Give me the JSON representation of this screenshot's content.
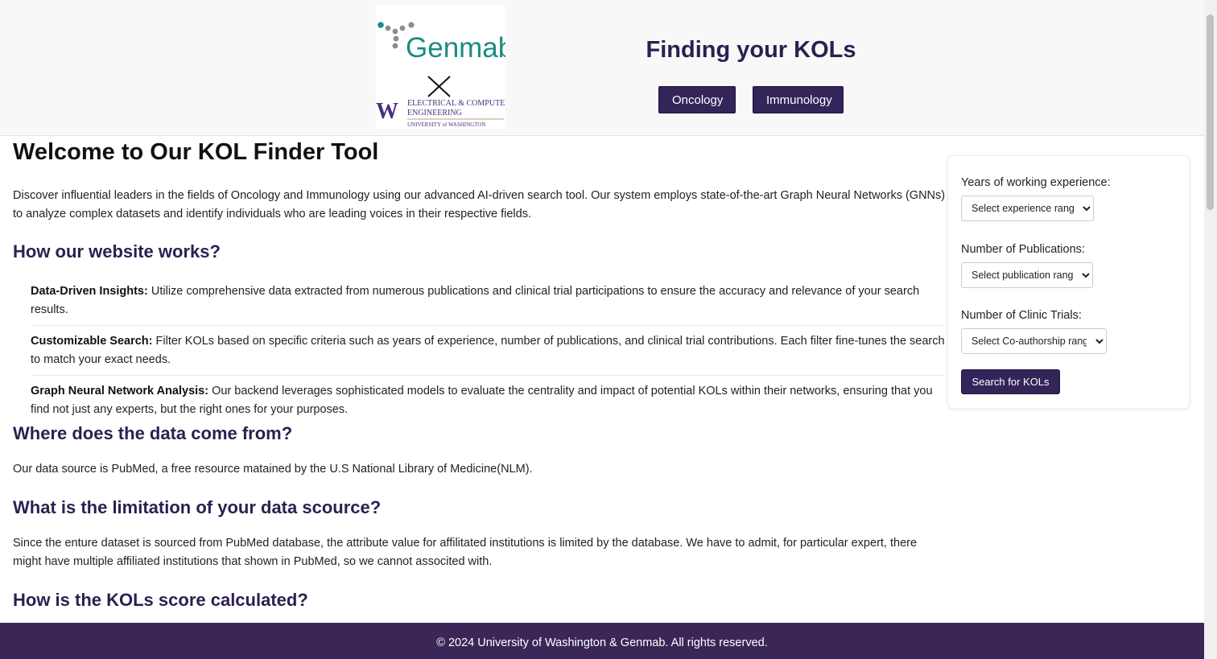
{
  "header": {
    "logo": {
      "brand": "Genmab",
      "cross": "X",
      "partner_line1": "ELECTRICAL & COMPUTER",
      "partner_line2": "ENGINEERING",
      "partner_line3": "UNIVERSITY of WASHINGTON",
      "partner_letter": "W"
    },
    "title": "Finding your KOLs",
    "nav": [
      {
        "label": "Oncology"
      },
      {
        "label": "Immunology"
      }
    ]
  },
  "main": {
    "heading": "Welcome to Our KOL Finder Tool",
    "intro": "Discover influential leaders in the fields of Oncology and Immunology using our advanced AI-driven search tool. Our system employs state-of-the-art Graph Neural Networks (GNNs) to analyze complex datasets and identify individuals who are leading voices in their respective fields.",
    "how_heading": "How our website works?",
    "features": [
      {
        "title": "Data-Driven Insights:",
        "text": " Utilize comprehensive data extracted from numerous publications and clinical trial participations to ensure the accuracy and relevance of your search results."
      },
      {
        "title": "Customizable Search:",
        "text": " Filter KOLs based on specific criteria such as years of experience, number of publications, and clinical trial contributions. Each filter fine-tunes the search to match your exact needs."
      },
      {
        "title": "Graph Neural Network Analysis:",
        "text": " Our backend leverages sophisticated models to evaluate the centrality and impact of potential KOLs within their networks, ensuring that you find not just any experts, but the right ones for your purposes."
      }
    ],
    "where_heading": "Where does the data come from?",
    "where_text": "Our data source is PubMed, a free resource matained by the U.S National Library of Medicine(NLM).",
    "limit_heading": "What is the limitation of your data scource?",
    "limit_text": "Since the enture dataset is sourced from PubMed database, the attribute value for affilitated institutions is limited by the database. We have to admit, for particular expert, there might have multiple affiliated institutions that shown in PubMed, so we cannot associted with.",
    "score_heading": "How is the KOLs score calculated?"
  },
  "filters": {
    "experience_label": "Years of working experience:",
    "experience_value": "Select experience range",
    "publications_label": "Number of Publications:",
    "publications_value": "Select publication range",
    "trials_label": "Number of Clinic Trials:",
    "trials_value": "Select Co-authorship range",
    "search_label": "Search for KOLs"
  },
  "footer": {
    "text": "© 2024 University of Washington & Genmab. All rights reserved."
  },
  "colors": {
    "accent": "#33245a",
    "heading": "#2d1f50",
    "footer_bg": "#3a2758",
    "genmab_teal": "#1a8c82",
    "uw_purple": "#4b2e83"
  }
}
